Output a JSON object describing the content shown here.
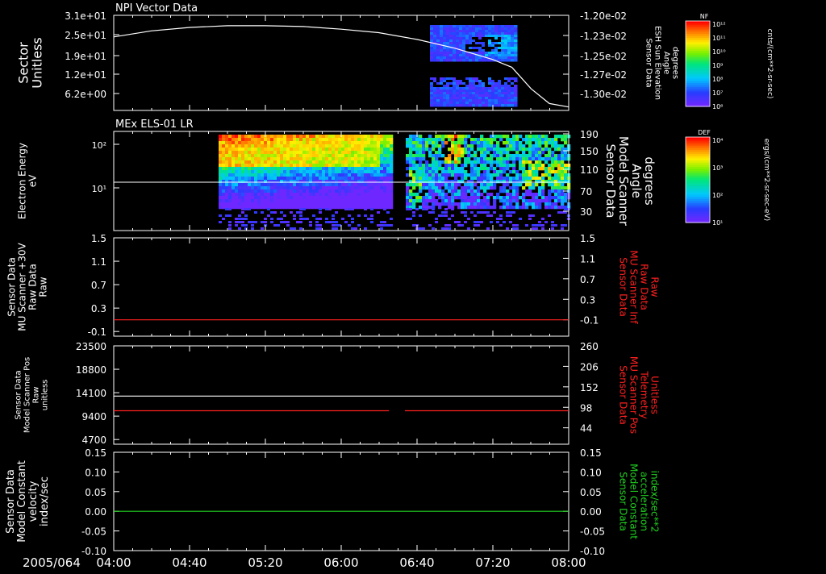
{
  "date_label": "2005/064",
  "time_ticks": [
    "04:00",
    "04:40",
    "05:20",
    "06:00",
    "06:40",
    "07:20",
    "08:00"
  ],
  "colors": {
    "background": "#000000",
    "axis": "#ffffff",
    "red_trace": "#ff2020",
    "green_trace": "#20d020"
  },
  "panels": [
    {
      "id": "npi",
      "title": "NPI Vector Data",
      "left_label": [
        "Sector",
        "Unitless"
      ],
      "left_ticks": [
        "3.1e+01",
        "2.5e+01",
        "1.9e+01",
        "1.2e+01",
        "6.2e+00"
      ],
      "right_label": [
        "Sensor Data",
        "ESH Sun Elevation",
        "Angle",
        "degrees"
      ],
      "right_ticks": [
        "-1.20e-02",
        "-1.23e-02",
        "-1.25e-02",
        "-1.27e-02",
        "-1.30e-02"
      ],
      "right_label_color": "#ffffff",
      "colorbar": {
        "label": "NF",
        "units": "cnts/(cm**2-sr-sec)",
        "ticks": [
          "10¹²",
          "10¹¹",
          "10¹⁰",
          "10⁹",
          "10⁸",
          "10⁷",
          "10⁶"
        ]
      }
    },
    {
      "id": "els",
      "title": "MEx ELS-01 LR",
      "left_label": [
        "Electron Energy",
        "eV"
      ],
      "left_ticks": [
        "10²",
        "10¹"
      ],
      "right_label": [
        "Sensor Data",
        "Model Scanner",
        "Angle",
        "degrees"
      ],
      "right_ticks": [
        "190",
        "150",
        "110",
        "70",
        "30"
      ],
      "right_label_color": "#ffffff",
      "colorbar": {
        "label": "DEF",
        "units": "ergs/(cm**2-sr-sec-eV)",
        "ticks": [
          "10⁴",
          "10³",
          "10²",
          "10¹"
        ]
      }
    },
    {
      "id": "mu30",
      "title": "",
      "left_label": [
        "Sensor Data",
        "MU Scanner +30V",
        "Raw Data",
        "Raw"
      ],
      "left_ticks": [
        "1.5",
        "1.1",
        "0.7",
        "0.3",
        "-0.1"
      ],
      "right_label": [
        "Sensor Data",
        "MU Scanner Inf",
        "Raw Data",
        "Raw"
      ],
      "right_ticks": [
        "1.5",
        "1.1",
        "0.7",
        "0.3",
        "-0.1"
      ],
      "right_label_color": "#ff2020"
    },
    {
      "id": "pos",
      "title": "",
      "left_label": [
        "Sensor Data",
        "Model Scanner Pos",
        "Raw",
        "unitless"
      ],
      "left_ticks": [
        "23500",
        "18800",
        "14100",
        "9400",
        "4700"
      ],
      "right_label": [
        "Sensor Data",
        "MU Scanner Pos",
        "Telemetry",
        "Unitless"
      ],
      "right_ticks": [
        "260",
        "206",
        "152",
        "98",
        "44"
      ],
      "right_label_color": "#ff2020"
    },
    {
      "id": "vel",
      "title": "",
      "left_label": [
        "Sensor Data",
        "Model Constant",
        "velocity",
        "index/sec"
      ],
      "left_ticks": [
        "0.15",
        "0.10",
        "0.05",
        "0.00",
        "-0.05",
        "-0.10"
      ],
      "right_label": [
        "Sensor Data",
        "Model Constant",
        "acceleration",
        "index/sec**2"
      ],
      "right_ticks": [
        "0.15",
        "0.10",
        "0.05",
        "0.00",
        "-0.05",
        "-0.10"
      ],
      "right_label_color": "#20d020"
    }
  ],
  "chart_data": [
    {
      "type": "line",
      "panel": "npi",
      "x_unit": "hours UT",
      "xlim": [
        4.0,
        8.0
      ],
      "ylim": [
        -0.0131,
        -0.012
      ],
      "series": [
        {
          "color": "#ffffff",
          "x": [
            4.0,
            4.33,
            4.67,
            5.0,
            5.33,
            5.67,
            6.0,
            6.33,
            6.67,
            7.0,
            7.33,
            7.5,
            7.67,
            7.83,
            8.0
          ],
          "y": [
            -0.01225,
            -0.01218,
            -0.01214,
            -0.01212,
            -0.01212,
            -0.01213,
            -0.01216,
            -0.0122,
            -0.01228,
            -0.01238,
            -0.01251,
            -0.0126,
            -0.01285,
            -0.01302,
            -0.01306
          ]
        }
      ],
      "heatmap_blocks": [
        {
          "x": [
            6.58,
            7.36
          ],
          "y": [
            20,
            31
          ]
        },
        {
          "x": [
            6.58,
            7.36
          ],
          "y": [
            2,
            10
          ]
        }
      ]
    },
    {
      "type": "heatmap",
      "panel": "els",
      "x_unit": "hours UT",
      "xlim": [
        4.0,
        8.0
      ],
      "y_scale": "log",
      "coverage": [
        [
          4.92,
          6.42
        ],
        [
          6.56,
          8.0
        ]
      ],
      "scanner_angle_line": 90
    },
    {
      "type": "line",
      "panel": "mu30",
      "xlim": [
        4.0,
        8.0
      ],
      "ylim": [
        -0.3,
        1.5
      ],
      "series": [
        {
          "color": "#ff2020",
          "x": [
            4.0,
            8.0
          ],
          "y": [
            0.0,
            0.0
          ]
        }
      ]
    },
    {
      "type": "line",
      "panel": "pos",
      "xlim": [
        4.0,
        8.0
      ],
      "ylim": [
        0,
        23500
      ],
      "series": [
        {
          "color": "#ffffff",
          "x": [
            4.0,
            8.0
          ],
          "y": [
            11500,
            11500
          ]
        },
        {
          "color": "#ff2020",
          "x": [
            4.0,
            6.42,
            6.56,
            8.0
          ],
          "y": [
            8000,
            8000,
            8000,
            8000
          ]
        }
      ]
    },
    {
      "type": "line",
      "panel": "vel",
      "xlim": [
        4.0,
        8.0
      ],
      "ylim": [
        -0.1,
        0.15
      ],
      "series": [
        {
          "color": "#20d020",
          "x": [
            4.0,
            8.0
          ],
          "y": [
            0.0,
            0.0
          ]
        }
      ]
    }
  ]
}
